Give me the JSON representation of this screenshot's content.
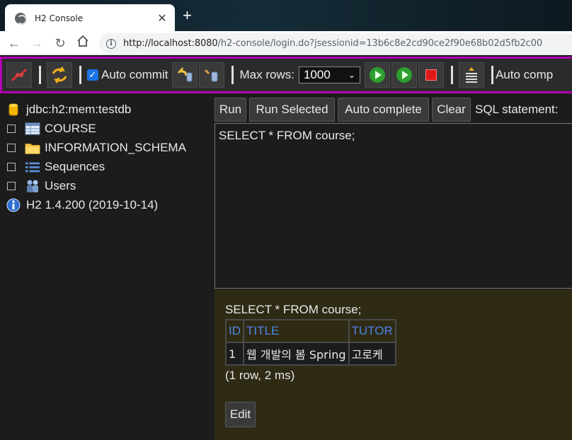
{
  "browser": {
    "tab_title": "H2 Console",
    "tab_close": "✕",
    "new_tab": "+",
    "url_host": "http://localhost:8080",
    "url_path": "/h2-console/login.do?jsessionid=13b6c8e2cd90ce2f90e68b02d5fb2c00"
  },
  "toolbar": {
    "auto_commit_label": "Auto commit",
    "max_rows_label": "Max rows:",
    "max_rows_value": "1000",
    "auto_complete_label": "Auto comp"
  },
  "tree": {
    "connection": "jdbc:h2:mem:testdb",
    "items": [
      {
        "label": "COURSE",
        "icon": "table-icon"
      },
      {
        "label": "INFORMATION_SCHEMA",
        "icon": "folder-icon"
      },
      {
        "label": "Sequences",
        "icon": "sequences-icon"
      },
      {
        "label": "Users",
        "icon": "users-icon"
      }
    ],
    "version": "H2 1.4.200 (2019-10-14)"
  },
  "query": {
    "buttons": {
      "run": "Run",
      "run_selected": "Run Selected",
      "auto_complete": "Auto complete",
      "clear": "Clear"
    },
    "sql_label": "SQL statement:",
    "sql_text": "SELECT * FROM course;"
  },
  "result": {
    "query_text": "SELECT * FROM course;",
    "columns": [
      "ID",
      "TITLE",
      "TUTOR"
    ],
    "rows": [
      [
        "1",
        "웹 개발의 봄 Spring",
        "고로케"
      ]
    ],
    "status": "(1 row, 2 ms)",
    "edit_label": "Edit"
  },
  "colors": {
    "toolbar_border": "#b000b0",
    "result_bg": "#2f2a14",
    "header_text": "#4a86e8"
  }
}
